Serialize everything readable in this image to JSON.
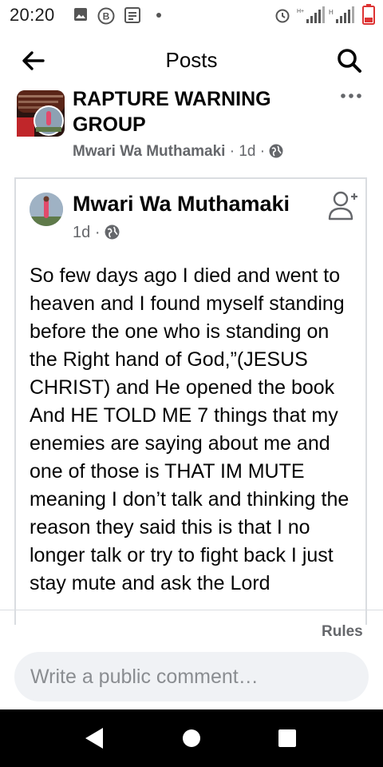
{
  "status_bar": {
    "time": "20:20"
  },
  "header": {
    "title": "Posts"
  },
  "group": {
    "name": "RAPTURE WARNING GROUP",
    "author": "Mwari Wa Muthamaki",
    "time": "1d"
  },
  "post": {
    "author": "Mwari Wa Muthamaki",
    "time": "1d",
    "text": "So few days ago I died and went to heaven and I found myself standing before the one who is standing on the Right hand of God,”(JESUS CHRIST) and He opened the book And HE TOLD ME 7 things that my enemies are saying about me and one of those is THAT IM MUTE meaning I don’t talk and thinking the reason they said this  is that I no longer talk or try to fight back I just stay mute and ask the Lord"
  },
  "footer": {
    "rules_label": "Rules",
    "comment_placeholder": "Write a public comment…"
  },
  "colors": {
    "text": "#050505",
    "secondary": "#65676b",
    "border": "#dadde1",
    "input_bg": "#f0f2f5"
  }
}
